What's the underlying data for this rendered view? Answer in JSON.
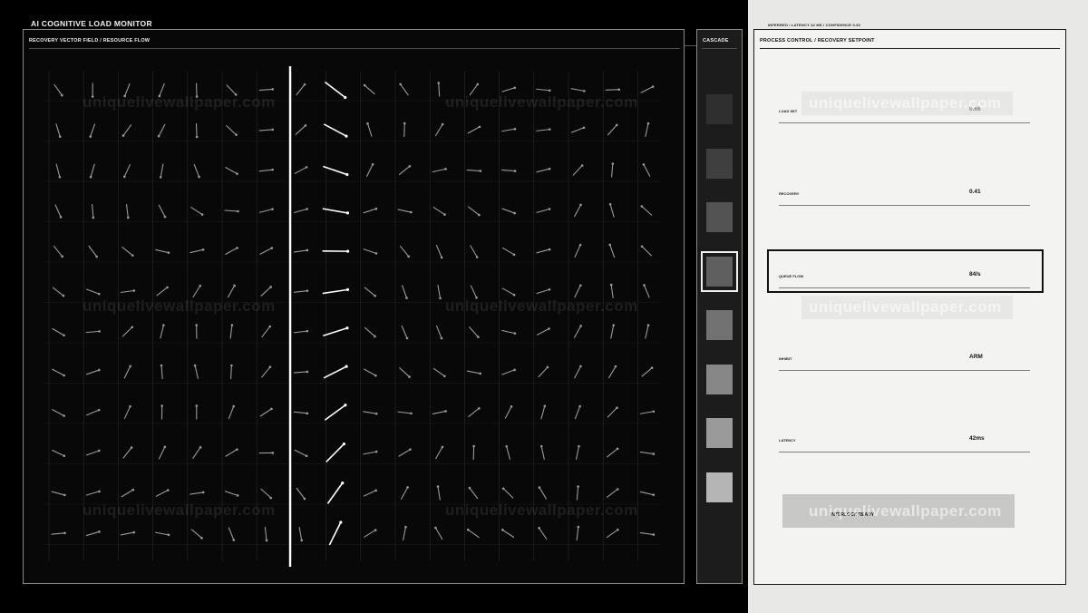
{
  "app_title": "AI COGNITIVE LOAD MONITOR",
  "meta": "INFERRED / LATENCY 42 MS / CONFIDENCE 0.92",
  "vector_field": {
    "title": "RECOVERY VECTOR FIELD / RESOURCE FLOW"
  },
  "cascade": {
    "title": "CASCADE",
    "stages": [
      {
        "color": "#2e2f2e"
      },
      {
        "color": "#3e3f3e"
      },
      {
        "color": "#525352"
      },
      {
        "color": "#5e5f5e"
      },
      {
        "color": "#717271"
      },
      {
        "color": "#868786"
      },
      {
        "color": "#999a99"
      },
      {
        "color": "#b4b5b4"
      }
    ],
    "selected_index": 3
  },
  "process_control": {
    "title": "PROCESS CONTROL / RECOVERY SETPOINT",
    "rows": [
      {
        "label": "LOAD SET",
        "value": "0.66"
      },
      {
        "label": "RECOVERY",
        "value": "0.41"
      },
      {
        "label": "QUEUE FLOW",
        "value": "84/s"
      },
      {
        "label": "INHIBIT",
        "value": "ARM"
      },
      {
        "label": "LATENCY",
        "value": "42ms"
      }
    ],
    "highlighted_row": 2,
    "interlock_label": "INTERLOCK READY"
  },
  "watermark": "uniquelivewallpaper.com",
  "colors": {
    "background": "#000000",
    "panel_dark": "#070807",
    "panel_light": "#f3f4f2",
    "vector": "#9a9a9a",
    "vector_highlight": "#ffffff"
  }
}
